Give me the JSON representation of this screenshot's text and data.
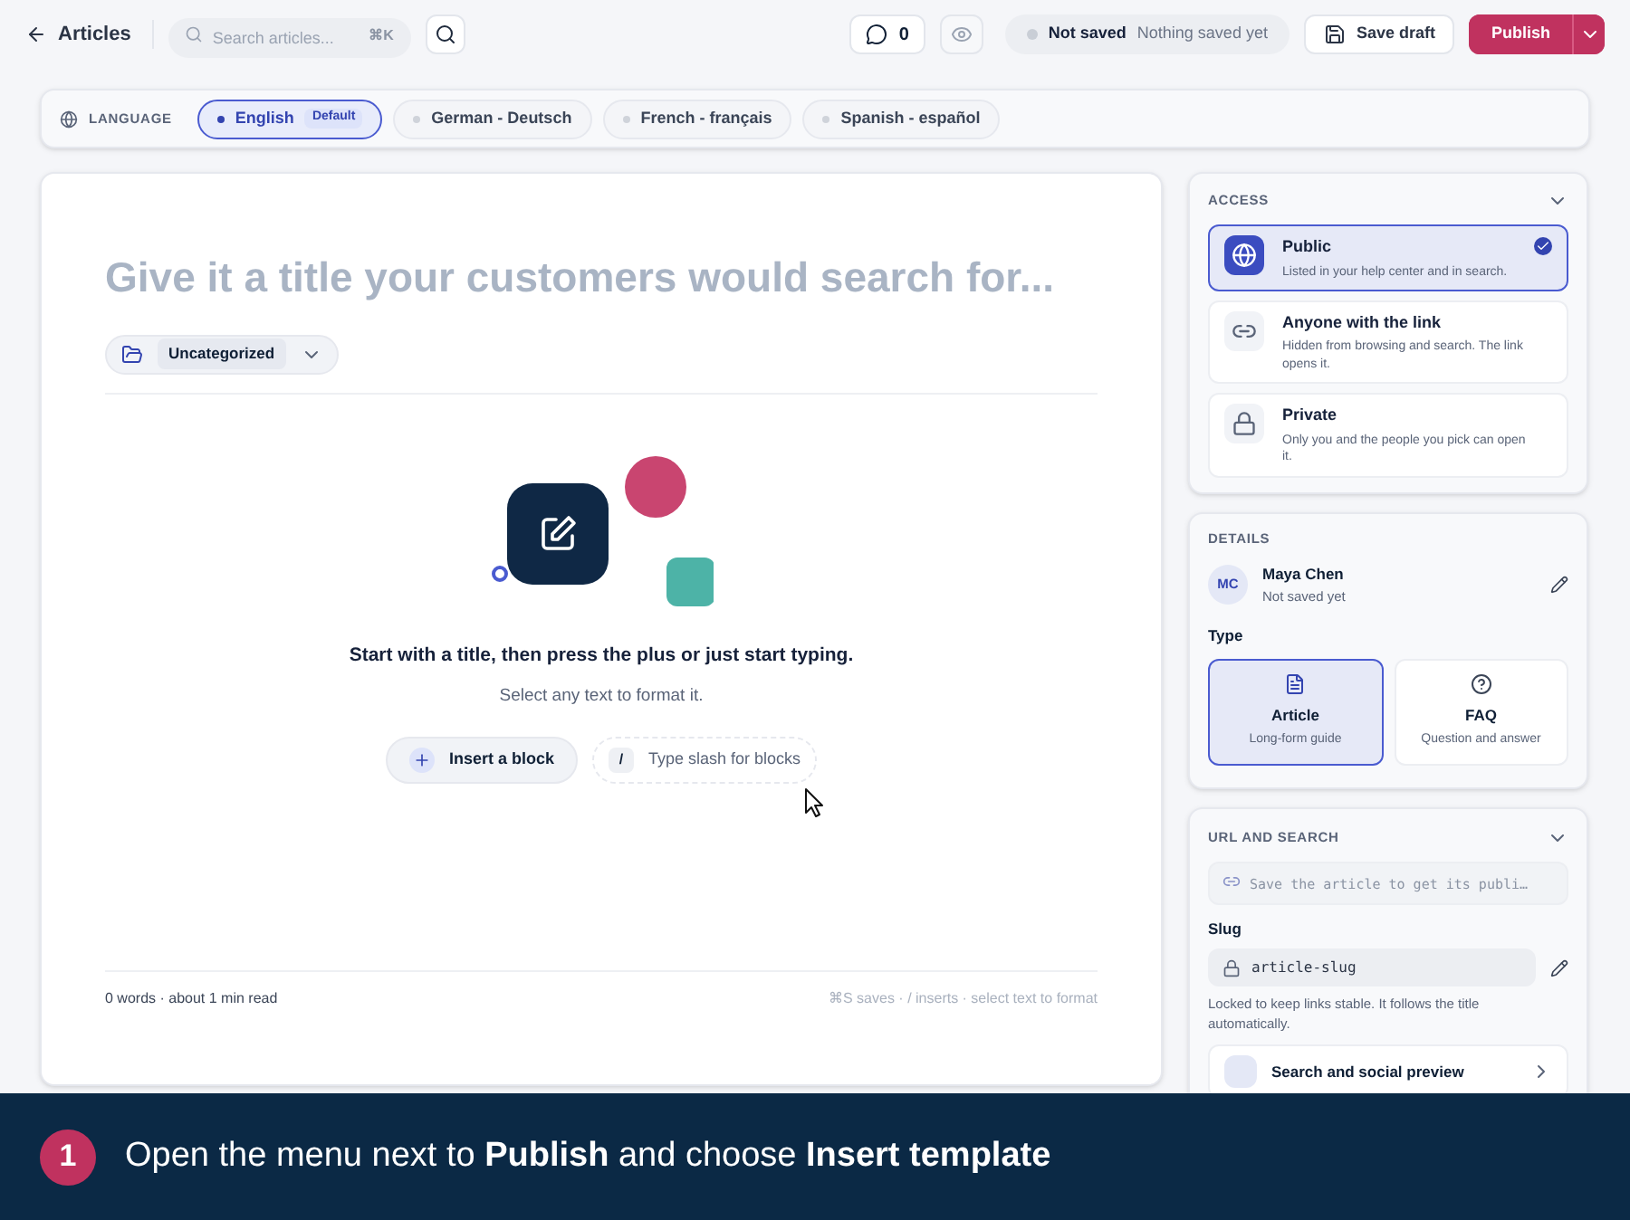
{
  "top_bar": {
    "back_link": "Articles",
    "search": {
      "placeholder": "Search articles...",
      "shortcut": "⌘K"
    },
    "comments_count": "0",
    "save_status": {
      "label": "Not saved",
      "detail": "Nothing saved yet"
    },
    "save_draft": "Save draft",
    "publish": "Publish"
  },
  "languages": {
    "label": "LANGUAGE",
    "items": [
      {
        "label": "English",
        "badge": "Default",
        "selected": true
      },
      {
        "label": "German - Deutsch",
        "selected": false
      },
      {
        "label": "French - français",
        "selected": false
      },
      {
        "label": "Spanish - español",
        "selected": false
      }
    ]
  },
  "editor": {
    "title_placeholder": "Give it a title your customers would search for...",
    "category": "Uncategorized",
    "heading": "Start with a title, then press the plus or just start typing.",
    "hint": "Select any text to format it.",
    "insert_button": "Insert a block",
    "slash_key": "/",
    "slash_hint": "Type slash for blocks",
    "word_count": "0 words · about 1 min read",
    "shortcuts": "⌘S saves · / inserts · select text to format"
  },
  "access": {
    "title": "ACCESS",
    "options": [
      {
        "name": "Public",
        "description": "Listed in your help center and in search.",
        "selected": true
      },
      {
        "name": "Anyone with the link",
        "description": "Hidden from browsing and search. The link opens it.",
        "selected": false
      },
      {
        "name": "Private",
        "description": "Only you and the people you pick can open it.",
        "selected": false
      }
    ]
  },
  "details": {
    "title": "DETAILS",
    "author": {
      "initials": "MC",
      "name": "Maya Chen",
      "status": "Not saved yet"
    },
    "type_label": "Type",
    "types": [
      {
        "name": "Article",
        "description": "Long-form guide",
        "selected": true
      },
      {
        "name": "FAQ",
        "description": "Question and answer",
        "selected": false
      }
    ]
  },
  "url_and_search": {
    "title": "URL AND SEARCH",
    "url_placeholder": "Save the article to get its publi…",
    "slug_label": "Slug",
    "slug": "article-slug",
    "slug_note": "Locked to keep links stable. It follows the title automatically.",
    "preview_link": "Search and social preview"
  },
  "banner": {
    "step": "1",
    "text": "Open the menu next to **Publish** and choose **Insert template**"
  }
}
